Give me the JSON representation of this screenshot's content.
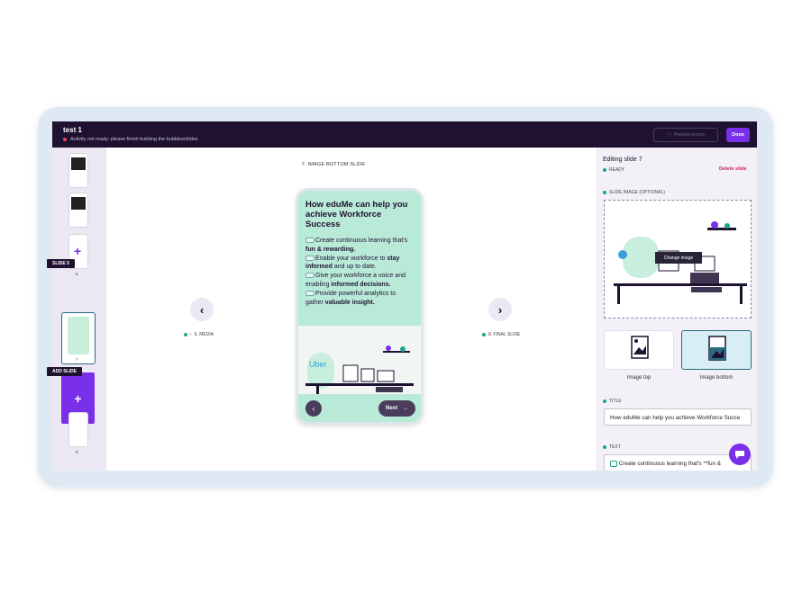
{
  "app": {
    "title": "test 1",
    "status": "Activity not ready: please finish building the bubbles/slides",
    "preview_label": "Preview lesson",
    "done_label": "Done"
  },
  "sidebar": {
    "slide_numbers": [
      "6",
      "7",
      "8"
    ],
    "slide5_tag": "SLIDE 5",
    "add_slide_tag": "ADD SLIDE"
  },
  "canvas": {
    "slide_label": "7. IMAGE BOTTOM SLIDE",
    "prev_label": "6. MEDIA",
    "next_label": "8. FINAL SLIDE"
  },
  "phone": {
    "title": "How eduMe can help you achieve Workforce Success",
    "line1_a": "Create continuous learning that's ",
    "line1_b": "fun & rewarding.",
    "line2_a": "Enable your workforce to ",
    "line2_b": "stay informed",
    "line2_c": " and up to date.",
    "line3_a": "Give your workforce a voice and enabling ",
    "line3_b": "informed decisions.",
    "line4_a": "Provide powerful analytics to gather ",
    "line4_b": "valuable insight.",
    "logo": "Uber",
    "next_label": "Next"
  },
  "panel": {
    "editing": "Editing slide 7",
    "ready": "READY",
    "delete": "Delete slide",
    "image_section": "SLIDE IMAGE (OPTIONAL)",
    "change_image": "Change image",
    "layout_top": "Image top",
    "layout_bottom": "Image bottom",
    "title_section": "TITLE",
    "title_value": "How eduMe can help you achieve Workforce Succe",
    "text_section": "TEXT",
    "text_value": "Create continuous learning that's **fun &"
  },
  "colors": {
    "brand_purple": "#7a2fe8",
    "topbar": "#1e1230",
    "mint": "#b9ead8",
    "delete_red": "#c5234f"
  }
}
